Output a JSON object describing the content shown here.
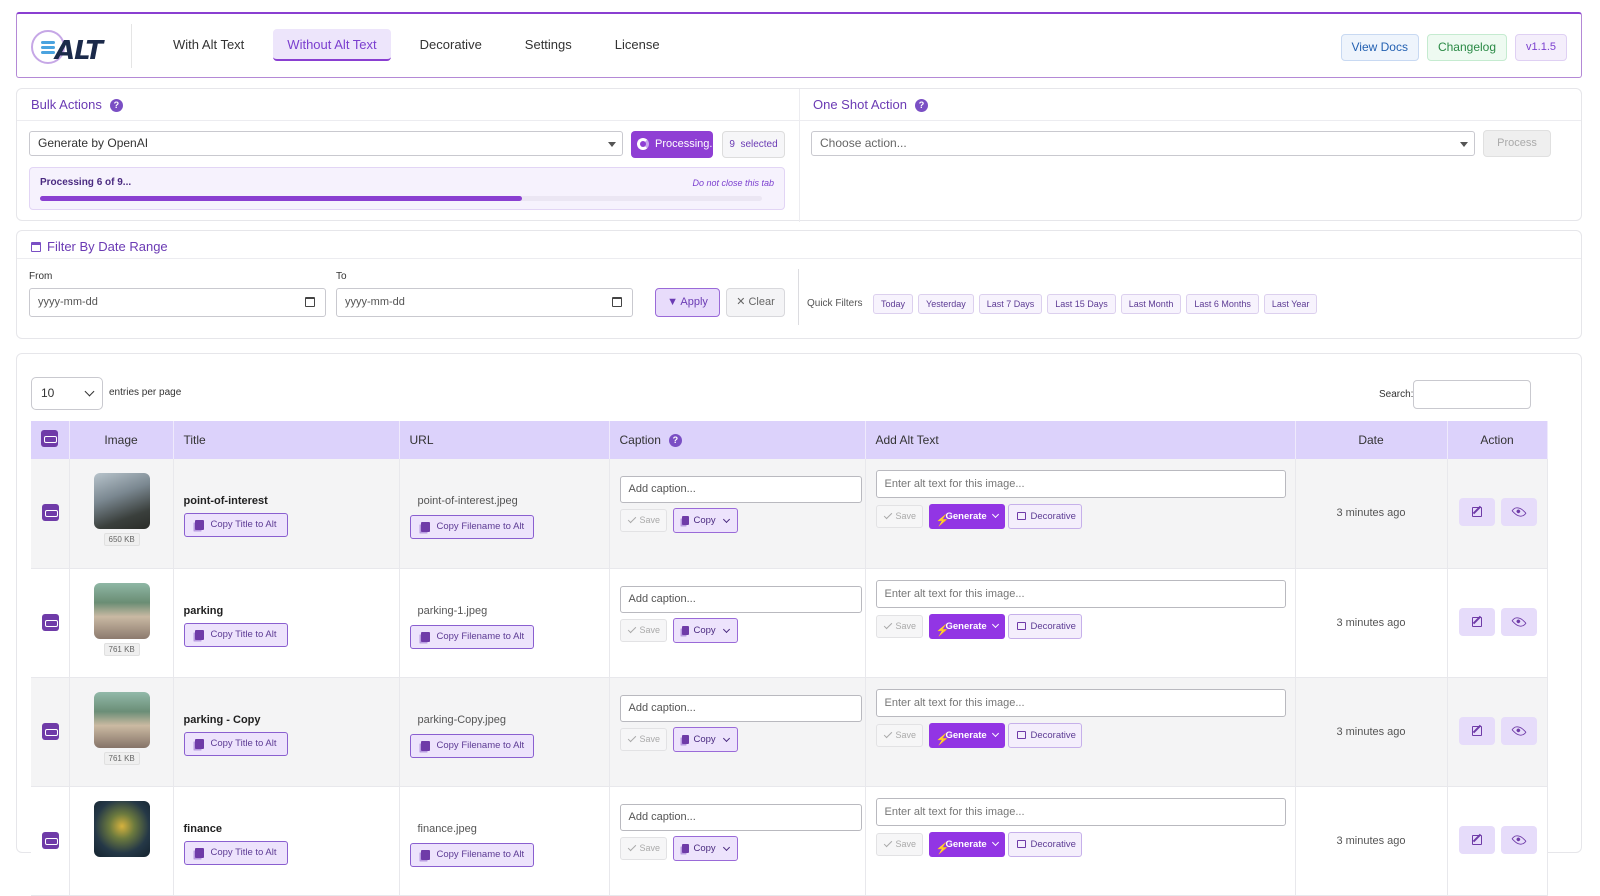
{
  "header": {
    "logo_text": "ALT",
    "tabs": [
      {
        "label": "With Alt Text",
        "active": false
      },
      {
        "label": "Without Alt Text",
        "active": true
      },
      {
        "label": "Decorative",
        "active": false
      },
      {
        "label": "Settings",
        "active": false
      },
      {
        "label": "License",
        "active": false
      }
    ],
    "view_docs": "View Docs",
    "changelog": "Changelog",
    "version": "v1.1.5"
  },
  "bulk": {
    "title": "Bulk Actions",
    "help": "?",
    "selected_action": "Generate by OpenAI",
    "processing_label": "Processing...",
    "selected_count": "9",
    "selected_label": "selected",
    "progress_text": "Processing 6 of 9...",
    "progress_note": "Do not close this tab",
    "progress_fraction": 0.667
  },
  "one_shot": {
    "title": "One Shot Action",
    "help": "?",
    "placeholder": "Choose action...",
    "process_label": "Process"
  },
  "filter": {
    "title": "Filter By Date Range",
    "from_label": "From",
    "to_label": "To",
    "from_placeholder": "yyyy-mm-dd",
    "to_placeholder": "yyyy-mm-dd",
    "apply_label": "Apply",
    "clear_label": "Clear",
    "quick_filters_label": "Quick Filters",
    "quick_filters": [
      "Today",
      "Yesterday",
      "Last 7 Days",
      "Last 15 Days",
      "Last Month",
      "Last 6 Months",
      "Last Year"
    ]
  },
  "table": {
    "per_page_value": "10",
    "per_page_label": "entries per page",
    "search_label": "Search:",
    "columns": {
      "image": "Image",
      "title": "Title",
      "url": "URL",
      "caption": "Caption",
      "alt": "Add Alt Text",
      "date": "Date",
      "action": "Action"
    },
    "caption_placeholder": "Add caption...",
    "alt_placeholder": "Enter alt text for this image...",
    "copy_title_label": "Copy Title to Alt",
    "copy_filename_label": "Copy Filename to Alt",
    "save_label": "Save",
    "copy_label": "Copy",
    "generate_label": "Generate",
    "decorative_label": "Decorative",
    "rows": [
      {
        "title": "point-of-interest",
        "url": "point-of-interest.jpeg",
        "size": "650 KB",
        "date": "3 minutes ago"
      },
      {
        "title": "parking",
        "url": "parking-1.jpeg",
        "size": "761 KB",
        "date": "3 minutes ago"
      },
      {
        "title": "parking - Copy",
        "url": "parking-Copy.jpeg",
        "size": "761 KB",
        "date": "3 minutes ago"
      },
      {
        "title": "finance",
        "url": "finance.jpeg",
        "size": "",
        "date": "3 minutes ago"
      }
    ]
  },
  "colors": {
    "accent": "#8a3fd1",
    "header_row": "#dcd2fb",
    "generate": "#9235e4"
  }
}
